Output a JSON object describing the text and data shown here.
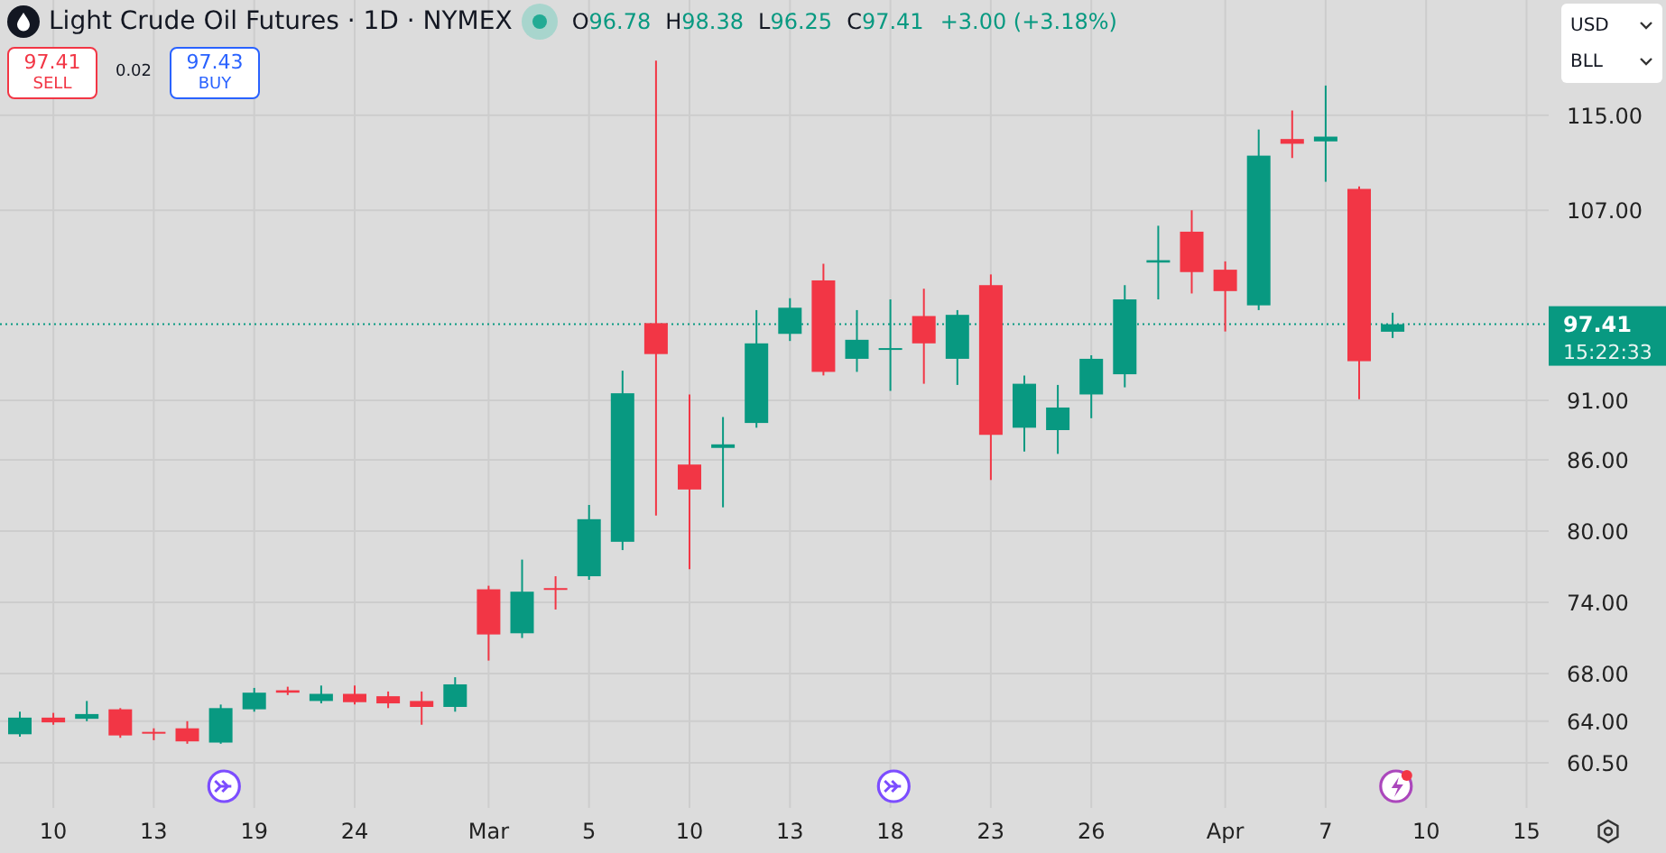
{
  "header": {
    "title": "Light Crude Oil Futures · 1D · NYMEX",
    "market_open": true,
    "ohlc": [
      {
        "label": "O",
        "value": "96.78"
      },
      {
        "label": "H",
        "value": "98.38"
      },
      {
        "label": "L",
        "value": "96.25"
      },
      {
        "label": "C",
        "value": "97.41"
      }
    ],
    "change": "+3.00 (+3.18%)"
  },
  "trade": {
    "sell": {
      "price": "97.41",
      "label": "SELL"
    },
    "spread": "0.02",
    "buy": {
      "price": "97.43",
      "label": "BUY"
    }
  },
  "selects": [
    {
      "value": "USD"
    },
    {
      "value": "BLL"
    }
  ],
  "chart": {
    "chart_data": {
      "type": "candlestick",
      "ylim": [
        56.7,
        124.7
      ],
      "categories": [
        null,
        "10",
        null,
        null,
        "13",
        null,
        null,
        "19",
        null,
        null,
        "24",
        null,
        null,
        null,
        "Mar",
        null,
        null,
        "5",
        null,
        null,
        "10",
        null,
        null,
        "13",
        null,
        null,
        "18",
        null,
        null,
        "23",
        null,
        null,
        "26",
        null,
        null,
        null,
        "Apr",
        null,
        null,
        "7",
        null,
        null,
        "10",
        null,
        null,
        "15"
      ],
      "ohlc": [
        [
          62.9,
          64.8,
          62.7,
          64.3
        ],
        [
          64.3,
          64.7,
          63.7,
          63.9
        ],
        [
          64.2,
          65.7,
          64.0,
          64.6
        ],
        [
          65.0,
          65.1,
          62.6,
          62.8
        ],
        [
          63.1,
          63.4,
          62.4,
          63.0
        ],
        [
          63.4,
          64.0,
          62.1,
          62.3
        ],
        [
          62.2,
          65.4,
          62.1,
          65.1
        ],
        [
          65.0,
          66.8,
          64.8,
          66.4
        ],
        [
          66.6,
          66.9,
          66.2,
          66.4
        ],
        [
          65.7,
          67.0,
          65.5,
          66.3
        ],
        [
          66.3,
          67.0,
          65.4,
          65.6
        ],
        [
          66.1,
          66.5,
          65.1,
          65.5
        ],
        [
          65.7,
          66.5,
          63.7,
          65.2
        ],
        [
          65.2,
          67.7,
          64.8,
          67.1
        ],
        [
          75.1,
          75.4,
          69.1,
          71.3
        ],
        [
          71.4,
          77.6,
          71.0,
          74.9
        ],
        [
          75.2,
          76.2,
          73.4,
          75.1
        ],
        [
          76.2,
          82.2,
          75.9,
          81.0
        ],
        [
          79.1,
          93.5,
          78.4,
          91.6
        ],
        [
          97.5,
          119.6,
          81.3,
          94.9
        ],
        [
          85.6,
          91.5,
          76.8,
          83.5
        ],
        [
          87.0,
          89.6,
          82.0,
          87.3
        ],
        [
          89.1,
          98.6,
          88.7,
          95.8
        ],
        [
          96.6,
          99.6,
          96.0,
          98.8
        ],
        [
          101.1,
          102.5,
          93.1,
          93.4
        ],
        [
          94.5,
          98.6,
          93.4,
          96.1
        ],
        [
          95.3,
          99.5,
          91.8,
          95.4
        ],
        [
          98.1,
          100.4,
          92.4,
          95.8
        ],
        [
          94.5,
          98.6,
          92.3,
          98.2
        ],
        [
          100.7,
          101.6,
          84.3,
          88.1
        ],
        [
          88.7,
          93.1,
          86.7,
          92.4
        ],
        [
          88.5,
          92.3,
          86.5,
          90.4
        ],
        [
          91.5,
          94.8,
          89.5,
          94.5
        ],
        [
          93.2,
          100.7,
          92.1,
          99.5
        ],
        [
          102.6,
          105.7,
          99.5,
          102.8
        ],
        [
          105.2,
          107.0,
          100.0,
          101.8
        ],
        [
          102.0,
          102.7,
          96.8,
          100.2
        ],
        [
          99.0,
          113.8,
          98.6,
          111.6
        ],
        [
          113.0,
          115.4,
          111.4,
          112.6
        ],
        [
          112.8,
          117.5,
          109.4,
          113.2
        ],
        [
          108.8,
          109.0,
          91.1,
          94.3
        ],
        [
          96.78,
          98.38,
          96.25,
          97.41
        ],
        null,
        null,
        null,
        null
      ],
      "yticks": [
        {
          "value": 115,
          "label": "115.00"
        },
        {
          "value": 107,
          "label": "107.00"
        },
        {
          "value": 91,
          "label": "91.00"
        },
        {
          "value": 86,
          "label": "86.00"
        },
        {
          "value": 80,
          "label": "80.00"
        },
        {
          "value": 74,
          "label": "74.00"
        },
        {
          "value": 68,
          "label": "68.00"
        },
        {
          "value": 64,
          "label": "64.00"
        },
        {
          "value": 60.5,
          "label": "60.50"
        }
      ],
      "grid": true,
      "ref_lines": [
        {
          "axis": "y",
          "value": 97.41
        }
      ]
    },
    "events": [
      {
        "kind": "arrow"
      },
      {
        "kind": "arrow"
      },
      {
        "kind": "lightning"
      }
    ]
  },
  "price_tag": {
    "price": "97.41",
    "countdown": "15:22:33"
  }
}
